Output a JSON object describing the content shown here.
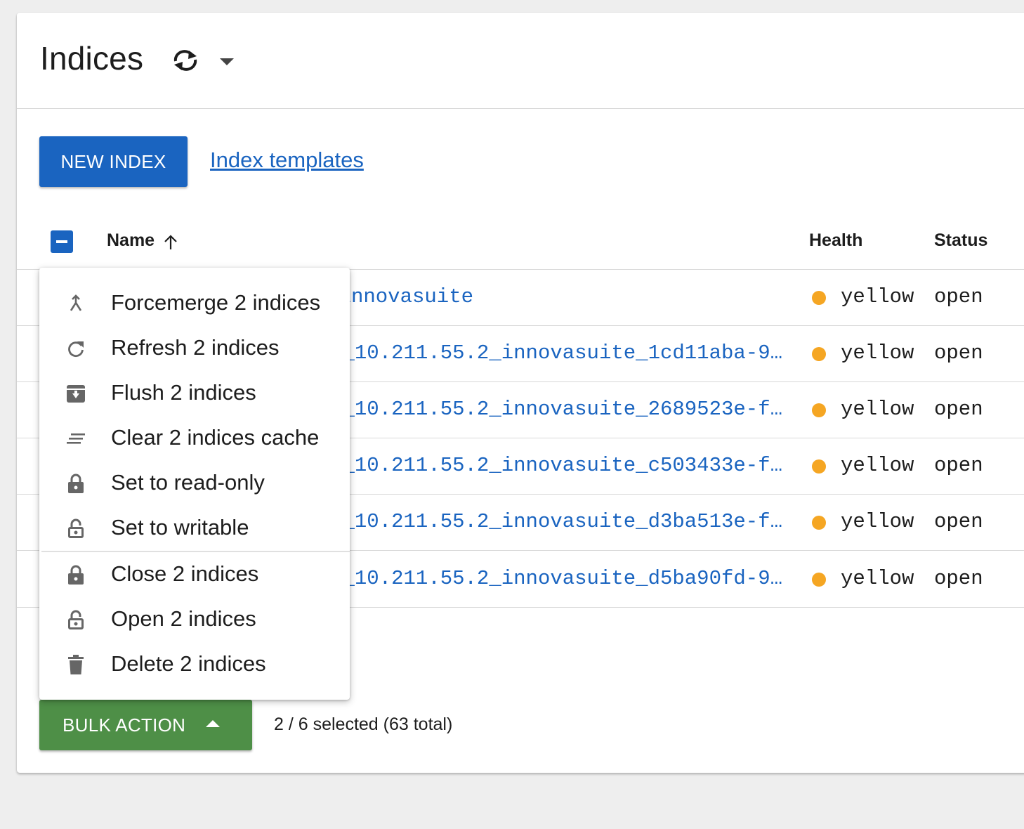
{
  "header": {
    "title": "Indices",
    "refresh_icon": "refresh-icon",
    "dropdown_icon": "caret-down-icon"
  },
  "toolbar": {
    "new_index_label": "NEW INDEX",
    "templates_link": "Index templates"
  },
  "table": {
    "columns": {
      "name": "Name",
      "health": "Health",
      "status": "Status"
    },
    "rows": [
      {
        "name": "innovasuite",
        "health": "yellow",
        "status": "open"
      },
      {
        "name": "s_10.211.55.2_innovasuite_1cd11aba-9…",
        "health": "yellow",
        "status": "open"
      },
      {
        "name": "s_10.211.55.2_innovasuite_2689523e-f…",
        "health": "yellow",
        "status": "open"
      },
      {
        "name": "s_10.211.55.2_innovasuite_c503433e-f…",
        "health": "yellow",
        "status": "open"
      },
      {
        "name": "s_10.211.55.2_innovasuite_d3ba513e-f…",
        "health": "yellow",
        "status": "open"
      },
      {
        "name": "s_10.211.55.2_innovasuite_d5ba90fd-9…",
        "health": "yellow",
        "status": "open"
      }
    ]
  },
  "bulk": {
    "label": "BULK ACTION",
    "selection_info": "2 / 6 selected (63 total)"
  },
  "menu": {
    "items": [
      {
        "label": "Forcemerge 2 indices",
        "icon": "merge-icon"
      },
      {
        "label": "Refresh 2 indices",
        "icon": "refresh-icon"
      },
      {
        "label": "Flush 2 indices",
        "icon": "archive-icon"
      },
      {
        "label": "Clear 2 indices cache",
        "icon": "clear-all-icon"
      },
      {
        "label": "Set to read-only",
        "icon": "lock-icon"
      },
      {
        "label": "Set to writable",
        "icon": "lock-open-icon"
      },
      {
        "label": "Close 2 indices",
        "icon": "lock-icon"
      },
      {
        "label": "Open 2 indices",
        "icon": "lock-open-icon"
      },
      {
        "label": "Delete 2 indices",
        "icon": "trash-icon"
      }
    ]
  },
  "colors": {
    "primary": "#1a64c0",
    "bulk_green": "#4e8f47",
    "health_yellow": "#f5a623"
  }
}
